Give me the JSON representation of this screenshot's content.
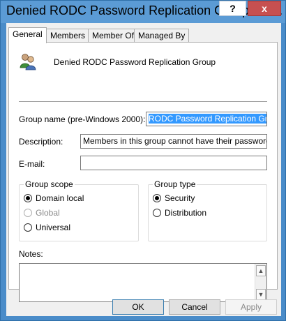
{
  "window": {
    "title": "Denied RODC Password Replication Group Pro...",
    "help_label": "?",
    "close_label": "x"
  },
  "tabs": [
    {
      "label": "General",
      "active": true
    },
    {
      "label": "Members"
    },
    {
      "label": "Member Of"
    },
    {
      "label": "Managed By"
    }
  ],
  "general": {
    "group_display_name": "Denied RODC Password Replication Group",
    "icon": "group-users-icon",
    "prewin_label": "Group name (pre-Windows 2000):",
    "prewin_value": "RODC Password Replication Group",
    "description_label": "Description:",
    "description_value": "Members in this group cannot have their passwords repli",
    "email_label": "E-mail:",
    "email_value": "",
    "scope": {
      "legend": "Group scope",
      "options": [
        "Domain local",
        "Global",
        "Universal"
      ],
      "selected": "Domain local",
      "disabled": [
        "Global"
      ]
    },
    "type": {
      "legend": "Group type",
      "options": [
        "Security",
        "Distribution"
      ],
      "selected": "Security"
    },
    "notes_label": "Notes:",
    "notes_value": ""
  },
  "buttons": {
    "ok": "OK",
    "cancel": "Cancel",
    "apply": "Apply"
  }
}
